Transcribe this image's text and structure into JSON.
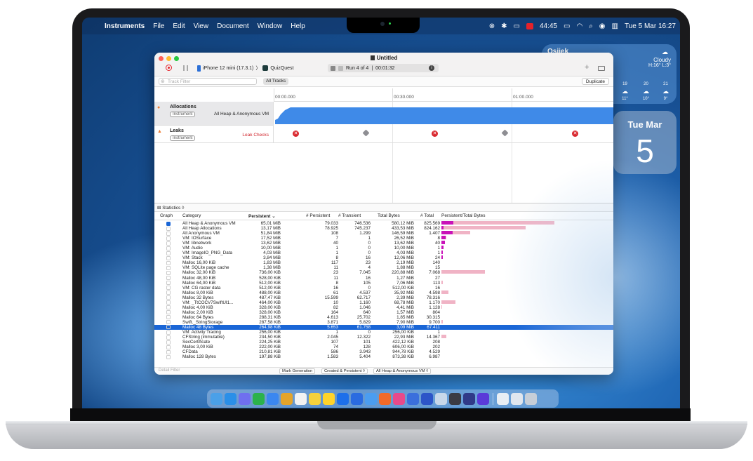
{
  "menubar": {
    "app": "Instruments",
    "items": [
      "File",
      "Edit",
      "View",
      "Document",
      "Window",
      "Help"
    ],
    "battery_time": "44:45",
    "datetime": "Tue 5 Mar  16:27"
  },
  "weather": {
    "city": "Osijek",
    "condition": "Cloudy",
    "hilo": "H:16° L:3°",
    "forecast": [
      {
        "hour": "19",
        "temp": "11°"
      },
      {
        "hour": "20",
        "temp": "10°"
      },
      {
        "hour": "21",
        "temp": "9°"
      }
    ]
  },
  "calendar": {
    "dow": "Tue Mar",
    "day": "5"
  },
  "window": {
    "title": "Untitled",
    "device": "iPhone 12 mini (17.3.1)",
    "target": "QuizQuest",
    "run": "Run 4 of 4",
    "run_time": "00:01:32",
    "track_filter_placeholder": "Track Filter",
    "all_tracks": "All Tracks",
    "duplicate": "Duplicate",
    "ruler": [
      "00:00.000",
      "00:30.000",
      "01:00.000"
    ],
    "tracks": [
      {
        "name": "Allocations",
        "badge": "Instrument",
        "desc": "All Heap & Anonymous VM"
      },
      {
        "name": "Leaks",
        "badge": "Instrument",
        "desc": "Leak Checks"
      }
    ],
    "stats_label": "Statistics ◊",
    "columns": [
      "Graph",
      "Category",
      "Persistent ⌄",
      "# Persistent",
      "# Transient",
      "Total Bytes",
      "# Total",
      "Persistent/Total Bytes"
    ],
    "rows": [
      {
        "c": "All Heap & Anonymous VM",
        "p": "65,01 MiB",
        "np": "79.033",
        "nt": "746.536",
        "tb": "580,12 MiB",
        "tot": "825.569",
        "checked": true,
        "b1": 0.075,
        "b2": 0.7
      },
      {
        "c": "All Heap Allocations",
        "p": "13,17 MiB",
        "np": "78.925",
        "nt": "745.237",
        "tb": "433,53 MiB",
        "tot": "824.162",
        "b1": 0.015,
        "b2": 0.52
      },
      {
        "c": "All Anonymous VM",
        "p": "51,84 MiB",
        "np": "108",
        "nt": "1.299",
        "tb": "146,59 MiB",
        "tot": "1.407",
        "b1": 0.07,
        "b2": 0.18
      },
      {
        "c": "VM: IOSurface",
        "p": "17,52 MiB",
        "np": "7",
        "nt": "1",
        "tb": "26,52 MiB",
        "tot": "8",
        "b1": 0.025,
        "b2": 0.03
      },
      {
        "c": "VM: libnetwork",
        "p": "13,62 MiB",
        "np": "40",
        "nt": "0",
        "tb": "13,62 MiB",
        "tot": "40",
        "b1": 0.02,
        "b2": 0.02
      },
      {
        "c": "VM: Audio",
        "p": "10,00 MiB",
        "np": "1",
        "nt": "0",
        "tb": "10,00 MiB",
        "tot": "1",
        "b1": 0.013,
        "b2": 0.013
      },
      {
        "c": "VM: ImageIO_PNG_Data",
        "p": "4,03 MiB",
        "np": "1",
        "nt": "0",
        "tb": "4,03 MiB",
        "tot": "1",
        "b1": 0.006,
        "b2": 0.006
      },
      {
        "c": "VM: Stack",
        "p": "3,84 MiB",
        "np": "8",
        "nt": "16",
        "tb": "12,06 MiB",
        "tot": "24",
        "b1": 0.006,
        "b2": 0.006
      },
      {
        "c": "Malloc 16,00 KiB",
        "p": "1,83 MiB",
        "np": "117",
        "nt": "23",
        "tb": "2,19 MiB",
        "tot": "140",
        "b1": 0,
        "b2": 0
      },
      {
        "c": "VM: SQLite page cache",
        "p": "1,38 MiB",
        "np": "11",
        "nt": "4",
        "tb": "1,88 MiB",
        "tot": "15",
        "b1": 0,
        "b2": 0
      },
      {
        "c": "Malloc 32,00 KiB",
        "p": "736,00 KiB",
        "np": "23",
        "nt": "7.045",
        "tb": "220,88 MiB",
        "tot": "7.068",
        "b1": 0,
        "b2": 0.27
      },
      {
        "c": "Malloc 48,00 KiB",
        "p": "528,00 KiB",
        "np": "11",
        "nt": "16",
        "tb": "1,27 MiB",
        "tot": "27",
        "b1": 0,
        "b2": 0
      },
      {
        "c": "Malloc 64,00 KiB",
        "p": "512,00 KiB",
        "np": "8",
        "nt": "105",
        "tb": "7,06 MiB",
        "tot": "113",
        "b1": 0,
        "b2": 0.008
      },
      {
        "c": "VM: CG raster data",
        "p": "512,00 KiB",
        "np": "16",
        "nt": "0",
        "tb": "512,00 KiB",
        "tot": "16",
        "b1": 0,
        "b2": 0
      },
      {
        "c": "Malloc 8,00 KiB",
        "p": "488,00 KiB",
        "np": "61",
        "nt": "4.537",
        "tb": "35,92 MiB",
        "tot": "4.598",
        "b1": 0,
        "b2": 0.045
      },
      {
        "c": "Malloc 32 Bytes",
        "p": "487,47 KiB",
        "np": "15.599",
        "nt": "62.717",
        "tb": "2,39 MiB",
        "tot": "78.316",
        "b1": 0,
        "b2": 0
      },
      {
        "c": "VM: _TtCOCV7SwiftUI1...",
        "p": "464,00 KiB",
        "np": "10",
        "nt": "1.160",
        "tb": "68,78 MiB",
        "tot": "1.170",
        "b1": 0,
        "b2": 0.085
      },
      {
        "c": "Malloc 4,00 KiB",
        "p": "328,00 KiB",
        "np": "82",
        "nt": "1.046",
        "tb": "4,41 MiB",
        "tot": "1.128",
        "b1": 0,
        "b2": 0.006
      },
      {
        "c": "Malloc 2,00 KiB",
        "p": "328,00 KiB",
        "np": "164",
        "nt": "640",
        "tb": "1,57 MiB",
        "tot": "804",
        "b1": 0,
        "b2": 0
      },
      {
        "c": "Malloc 64 Bytes",
        "p": "288,31 KiB",
        "np": "4.613",
        "nt": "25.702",
        "tb": "1,85 MiB",
        "tot": "30.315",
        "b1": 0,
        "b2": 0
      },
      {
        "c": "Swift._StringStorage",
        "p": "287,58 KiB",
        "np": "3.871",
        "nt": "5.829",
        "tb": "7,90 MiB",
        "tot": "9.700",
        "b1": 0,
        "b2": 0.008
      },
      {
        "c": "Malloc 48 Bytes",
        "p": "264,98 KiB",
        "np": "5.653",
        "nt": "61.758",
        "tb": "3,09 MiB",
        "tot": "67.411",
        "selected": true,
        "b1": 0,
        "b2": 0
      },
      {
        "c": "VM: Activity Tracing",
        "p": "256,00 KiB",
        "np": "1",
        "nt": "0",
        "tb": "256,00 KiB",
        "tot": "1",
        "b1": 0,
        "b2": 0
      },
      {
        "c": "CFString (immutable)",
        "p": "234,50 KiB",
        "np": "2.045",
        "nt": "12.322",
        "tb": "22,93 MiB",
        "tot": "14.367",
        "b1": 0,
        "b2": 0.03
      },
      {
        "c": "SecCertificate",
        "p": "224,25 KiB",
        "np": "107",
        "nt": "101",
        "tb": "422,12 KiB",
        "tot": "208",
        "b1": 0,
        "b2": 0
      },
      {
        "c": "Malloc 3,00 KiB",
        "p": "222,00 KiB",
        "np": "74",
        "nt": "128",
        "tb": "606,00 KiB",
        "tot": "202",
        "b1": 0,
        "b2": 0
      },
      {
        "c": "CFData",
        "p": "210,81 KiB",
        "np": "586",
        "nt": "3.943",
        "tb": "944,78 KiB",
        "tot": "4.529",
        "b1": 0,
        "b2": 0
      },
      {
        "c": "Malloc 128 Bytes",
        "p": "197,88 KiB",
        "np": "1.583",
        "nt": "5.404",
        "tb": "873,38 KiB",
        "tot": "6.987",
        "b1": 0,
        "b2": 0
      }
    ],
    "detail_filter": "Detail Filter",
    "mark_generation": "Mark Generation",
    "created_persistent": "Created & Persistent ◊",
    "heap_select": "All Heap & Anonymous VM ◊"
  },
  "colors": {
    "accent": "#1a66d6",
    "bar_persistent": "#c912b8",
    "bar_total": "#f0b3c5"
  }
}
